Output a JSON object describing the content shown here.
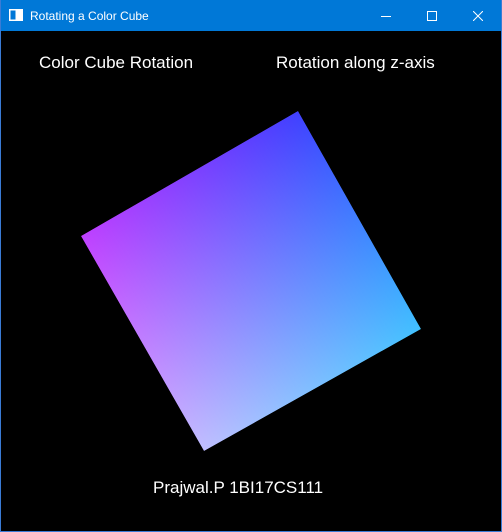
{
  "window": {
    "title": "Rotating a Color Cube",
    "controls": {
      "minimize_icon": "minimize-icon",
      "maximize_icon": "maximize-icon",
      "close_icon": "close-icon"
    },
    "titlebar_color": "#0078d7"
  },
  "scene": {
    "heading_left": "Color Cube Rotation",
    "heading_right": "Rotation along z-axis",
    "footer_text": "Prajwal.P 1BI17CS111",
    "background_color": "#000000",
    "cube_face_colors": {
      "top": "#0000ff",
      "left": "#ff00ff",
      "right": "#00ffff",
      "bottom": "#ffffff"
    }
  }
}
